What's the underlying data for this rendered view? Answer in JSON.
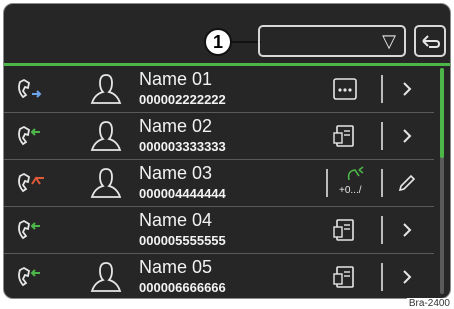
{
  "header": {
    "callout_number": "1",
    "dropdown_arrow": "▽"
  },
  "contacts": [
    {
      "name": "Name 01",
      "number": "000002222222",
      "call_type": "outgoing",
      "call_color": "#6aa6e8",
      "action": "more",
      "edit": false
    },
    {
      "name": "Name 02",
      "number": "000003333333",
      "call_type": "incoming",
      "call_color": "#4cb648",
      "action": "phonebook",
      "edit": false
    },
    {
      "name": "Name 03",
      "number": "000004444444",
      "call_type": "missed",
      "call_color": "#e05a3a",
      "action": "add-number",
      "action_label": "+0.../",
      "edit": true
    },
    {
      "name": "Name 04",
      "number": "000005555555",
      "call_type": "incoming",
      "call_color": "#4cb648",
      "action": "phonebook",
      "edit": false,
      "no_avatar": true
    },
    {
      "name": "Name 05",
      "number": "000006666666",
      "call_type": "incoming",
      "call_color": "#4cb648",
      "action": "phonebook",
      "edit": false
    }
  ],
  "footer_tag": "Bra-2400",
  "colors": {
    "accent": "#4cb648",
    "background": "#262626",
    "text": "#f2f2f2"
  }
}
